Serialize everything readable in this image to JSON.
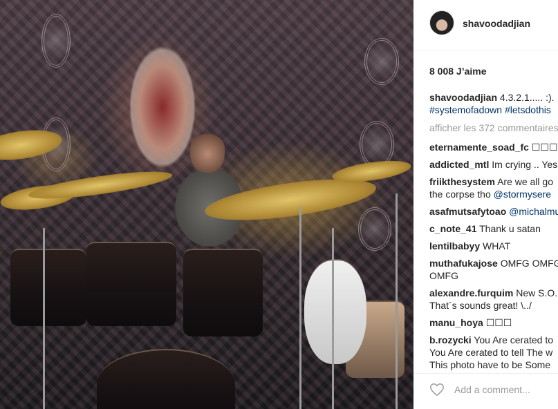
{
  "post": {
    "username": "shavoodadjian",
    "likes": "8 008 J’aime",
    "caption": {
      "user": "shavoodadjian",
      "text": "4.3.2.1..... :).",
      "hashtags": "#systemofadown #letsdothis"
    },
    "view_all_comments": "afficher les 372 commentaires"
  },
  "comments": [
    {
      "user": "eternamente_soad_fc",
      "text": "☐☐☐"
    },
    {
      "user": "addicted_mtl",
      "text": "Im crying .. Yes"
    },
    {
      "user": "friikthesystem",
      "text": "Are we all go",
      "line2": "the corpse tho",
      "mention": "@stormysere"
    },
    {
      "user": "asafmutsafytoao",
      "mention": "@michalmu"
    },
    {
      "user": "c_note_41",
      "text": "Thank u satan"
    },
    {
      "user": "lentilbabyy",
      "text": "WHAT"
    },
    {
      "user": "muthafukajose",
      "text": "OMFG OMFG",
      "line2": "OMFG"
    },
    {
      "user": "alexandre.furquim",
      "text": "New S.O.",
      "line2": "That´s sounds great! \\../"
    },
    {
      "user": "manu_hoya",
      "text": "☐☐☐"
    },
    {
      "user": "b.rozycki",
      "text": "You Are cerated to",
      "line2": "You Are cerated to tell The w",
      "line3": "This photo have to be Some"
    }
  ],
  "footer": {
    "like_icon": "heart-icon",
    "add_comment_placeholder": "Add a comment..."
  }
}
